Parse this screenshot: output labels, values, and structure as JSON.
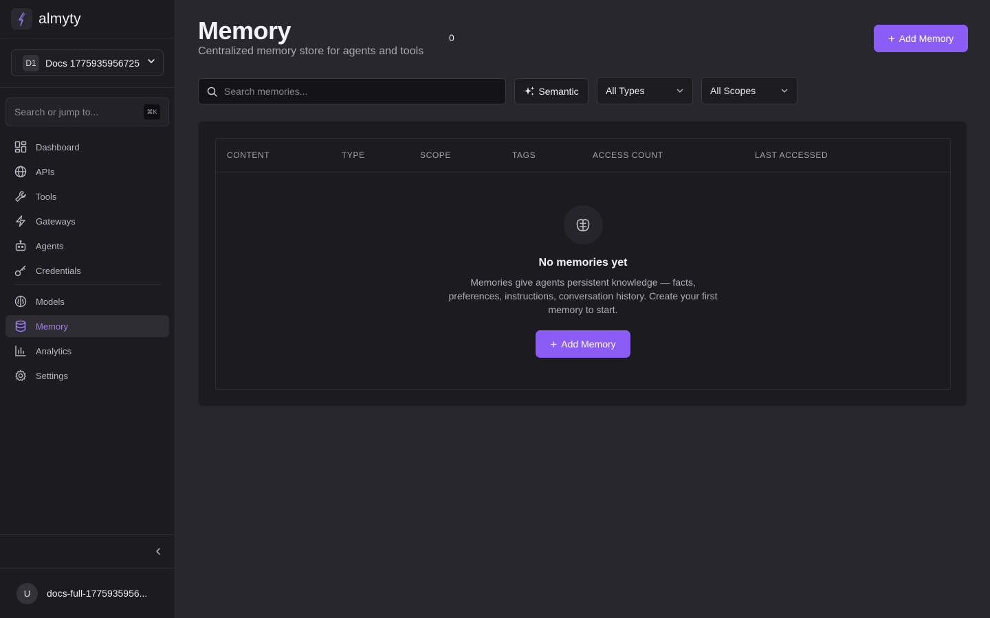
{
  "brand": {
    "name": "almyty"
  },
  "org": {
    "badge": "D1",
    "name": "Docs 1775935956725"
  },
  "sidebar_search": {
    "placeholder": "Search or jump to...",
    "shortcut": "⌘K"
  },
  "nav": {
    "items": [
      {
        "label": "Dashboard",
        "icon": "dashboard-icon"
      },
      {
        "label": "APIs",
        "icon": "globe-icon"
      },
      {
        "label": "Tools",
        "icon": "wrench-icon"
      },
      {
        "label": "Gateways",
        "icon": "lightning-icon"
      },
      {
        "label": "Agents",
        "icon": "robot-icon"
      },
      {
        "label": "Credentials",
        "icon": "key-icon"
      }
    ],
    "items2": [
      {
        "label": "Models",
        "icon": "brain-icon"
      },
      {
        "label": "Memory",
        "icon": "database-icon",
        "active": true
      },
      {
        "label": "Analytics",
        "icon": "bar-chart-icon"
      },
      {
        "label": "Settings",
        "icon": "gear-icon"
      }
    ]
  },
  "user": {
    "initial": "U",
    "name": "docs-full-1775935956..."
  },
  "header": {
    "title": "Memory",
    "subtitle": "Centralized memory store for agents and tools",
    "count": "0",
    "add_label": "Add Memory"
  },
  "filters": {
    "search_placeholder": "Search memories...",
    "semantic_label": "Semantic",
    "type_selected": "All Types",
    "scope_selected": "All Scopes"
  },
  "table": {
    "columns": [
      "CONTENT",
      "TYPE",
      "SCOPE",
      "TAGS",
      "ACCESS COUNT",
      "LAST ACCESSED"
    ]
  },
  "empty_state": {
    "icon": "brain-icon",
    "title": "No memories yet",
    "text": "Memories give agents persistent knowledge — facts, preferences, instructions, conversation history. Create your first memory to start.",
    "button_label": "Add Memory"
  },
  "colors": {
    "accent": "#8b5cf6",
    "active_nav": "#a27cf6"
  }
}
